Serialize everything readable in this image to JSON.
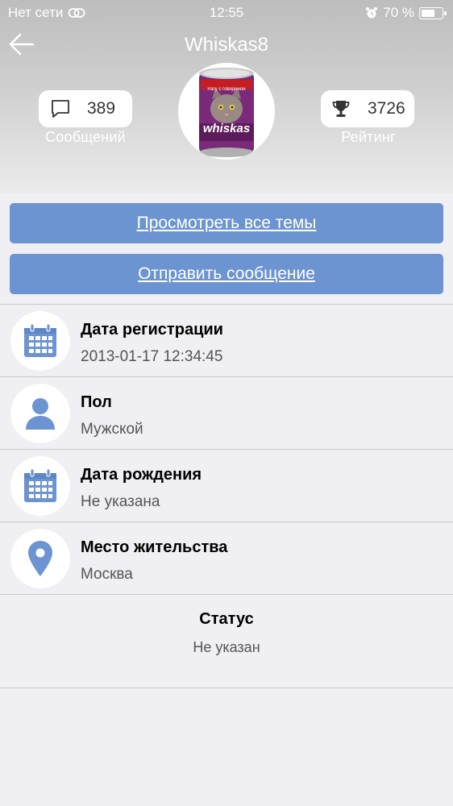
{
  "status_bar": {
    "carrier": "Нет сети",
    "time": "12:55",
    "battery_percent": "70 %",
    "battery_level": 0.7
  },
  "header": {
    "title": "Whiskas8",
    "messages": {
      "count": "389",
      "label": "Сообщений",
      "icon": "speech-bubble-icon"
    },
    "rating": {
      "count": "3726",
      "label": "Рейтинг",
      "icon": "trophy-icon"
    },
    "avatar": {
      "brand_text": "whiskas",
      "sticker_text": "Рагу с говядиной"
    }
  },
  "actions": {
    "view_topics": "Просмотреть все темы",
    "send_message": "Отправить сообщение"
  },
  "profile": {
    "registration": {
      "title": "Дата регистрации",
      "value": "2013-01-17 12:34:45",
      "icon": "calendar-icon"
    },
    "gender": {
      "title": "Пол",
      "value": "Мужской",
      "icon": "person-icon"
    },
    "birthdate": {
      "title": "Дата рождения",
      "value": "Не указана",
      "icon": "calendar-icon"
    },
    "location": {
      "title": "Место жительства",
      "value": "Москва",
      "icon": "location-pin-icon"
    },
    "status": {
      "title": "Статус",
      "value": "Не указан"
    }
  },
  "colors": {
    "accent": "#6c94d1",
    "icon_blue": "#6c94d1",
    "background": "#efeff4"
  }
}
